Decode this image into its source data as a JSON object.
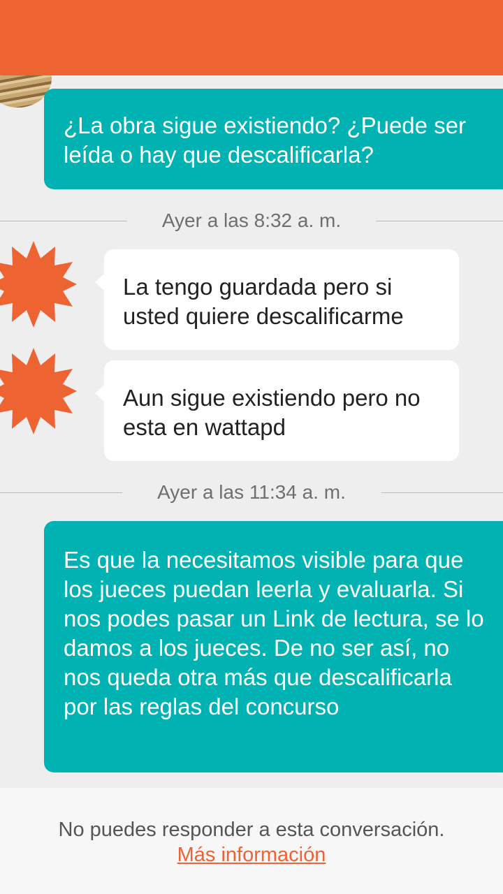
{
  "colors": {
    "accent": "#ee6332",
    "sent_bubble": "#00b2b2",
    "received_bubble": "#ffffff"
  },
  "messages": [
    {
      "type": "sent",
      "text": "¿La obra sigue existiendo? ¿Puede ser leída o hay que descalificarla?"
    },
    {
      "type": "separator",
      "text": "Ayer a las 8:32 a. m."
    },
    {
      "type": "received",
      "text": "La tengo guardada pero si usted quiere descalificarme"
    },
    {
      "type": "received",
      "text": "Aun sigue existiendo pero no esta en wattapd"
    },
    {
      "type": "separator",
      "text": "Ayer a las 11:34 a. m."
    },
    {
      "type": "sent",
      "text": "Es que la necesitamos visible para que los jueces puedan leerla y evaluarla. Si nos podes pasar un Link de lectura, se lo damos a los jueces. De no ser así, no nos queda otra más que descalificarla por las reglas del concurso"
    }
  ],
  "footer": {
    "notice": "No puedes responder a esta conversación.",
    "link": "Más información"
  },
  "icons": {
    "avatar_received": "orange-starburst-avatar",
    "avatar_partial": "avatar"
  }
}
